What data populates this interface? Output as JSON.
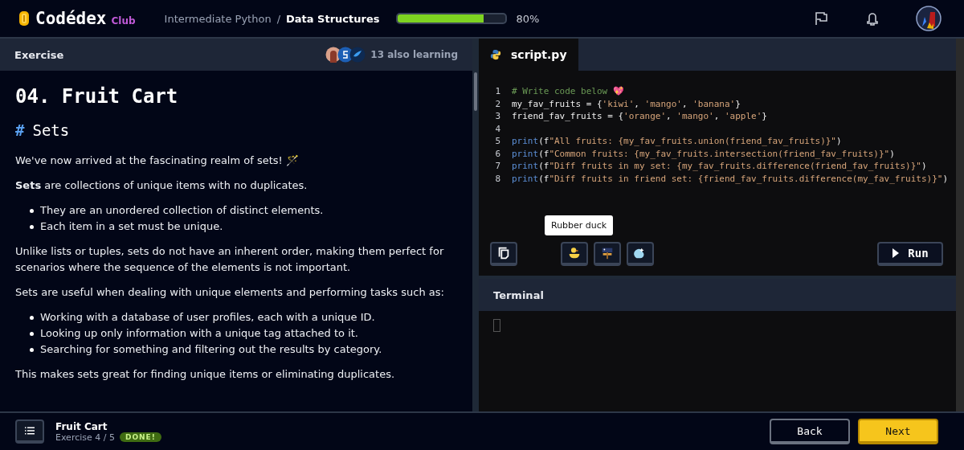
{
  "header": {
    "logo": "Codédex",
    "logo_badge": "Club",
    "breadcrumb": [
      {
        "label": "Intermediate Python",
        "current": false
      },
      {
        "label": "Data Structures",
        "current": true
      }
    ],
    "separator": "/",
    "progress": {
      "level": 0.8,
      "reading": "80%"
    }
  },
  "exercise_panel": {
    "title": "Exercise",
    "learners": "13 also learning",
    "heading": "04. Fruit Cart",
    "subheading_mark": "#",
    "subheading": "Sets",
    "blocks": [
      {
        "kind": "paragraph",
        "text": "We've now arrived at the fascinating realm of sets! 🪄"
      },
      {
        "kind": "paragraph",
        "text": "**Sets** are collections of unique items with no duplicates."
      },
      {
        "kind": "list",
        "items": [
          "They are an unordered collection of distinct elements.",
          "Each item in a set must be unique."
        ]
      },
      {
        "kind": "paragraph",
        "text": "Unlike lists or tuples, sets do not have an inherent order, making them perfect for scenarios where the sequence of the elements is not important."
      },
      {
        "kind": "paragraph",
        "text": "Sets are useful when dealing with unique elements and performing tasks such as:"
      },
      {
        "kind": "list",
        "items": [
          "Working with a database of user profiles, each with a unique ID.",
          "Looking up only information with a unique tag attached to it.",
          "Searching for something and filtering out the results by category."
        ]
      },
      {
        "kind": "paragraph",
        "text": "This makes sets great for finding unique items or eliminating duplicates."
      }
    ]
  },
  "editor": {
    "tab": "script.py",
    "lines": [
      {
        "number": "1",
        "tokens": [
          {
            "kind": "comment",
            "text": "# Write code below 💖"
          }
        ]
      },
      {
        "number": "2",
        "tokens": [
          {
            "kind": "plain",
            "text": "my_fav_fruits = {"
          },
          {
            "kind": "string",
            "text": "'kiwi'"
          },
          {
            "kind": "plain",
            "text": ", "
          },
          {
            "kind": "string",
            "text": "'mango'"
          },
          {
            "kind": "plain",
            "text": ", "
          },
          {
            "kind": "string",
            "text": "'banana'"
          },
          {
            "kind": "plain",
            "text": "}"
          }
        ]
      },
      {
        "number": "3",
        "tokens": [
          {
            "kind": "plain",
            "text": "friend_fav_fruits = {"
          },
          {
            "kind": "string",
            "text": "'orange'"
          },
          {
            "kind": "plain",
            "text": ", "
          },
          {
            "kind": "string",
            "text": "'mango'"
          },
          {
            "kind": "plain",
            "text": ", "
          },
          {
            "kind": "string",
            "text": "'apple'"
          },
          {
            "kind": "plain",
            "text": "}"
          }
        ]
      },
      {
        "number": "4"
      },
      {
        "number": "5",
        "tokens": [
          {
            "kind": "builtin",
            "text": "print"
          },
          {
            "kind": "plain",
            "text": "(f"
          },
          {
            "kind": "string",
            "text": "\"All fruits: {my_fav_fruits.union(friend_fav_fruits)}\""
          },
          {
            "kind": "plain",
            "text": ")"
          }
        ]
      },
      {
        "number": "6",
        "tokens": [
          {
            "kind": "builtin",
            "text": "print"
          },
          {
            "kind": "plain",
            "text": "(f"
          },
          {
            "kind": "string",
            "text": "\"Common fruits: {my_fav_fruits.intersection(friend_fav_fruits)}\""
          },
          {
            "kind": "plain",
            "text": ")"
          }
        ]
      },
      {
        "number": "7",
        "tokens": [
          {
            "kind": "builtin",
            "text": "print"
          },
          {
            "kind": "plain",
            "text": "(f"
          },
          {
            "kind": "string",
            "text": "\"Diff fruits in my set: {my_fav_fruits.difference(friend_fav_fruits)}\""
          },
          {
            "kind": "plain",
            "text": ")"
          }
        ]
      },
      {
        "number": "8",
        "tokens": [
          {
            "kind": "builtin",
            "text": "print"
          },
          {
            "kind": "plain",
            "text": "(f"
          },
          {
            "kind": "string",
            "text": "\"Diff fruits in friend set: {friend_fav_fruits.difference(my_fav_fruits)}\""
          },
          {
            "kind": "plain",
            "text": ")"
          }
        ]
      }
    ],
    "tooltip": "Rubber duck",
    "run_button": "Run"
  },
  "terminal": {
    "title": "Terminal"
  },
  "footer": {
    "title": "Fruit Cart",
    "subtitle": "Exercise 4 / 5",
    "badge": "DONE!",
    "buttons": [
      {
        "label": "Back",
        "kind": "secondary"
      },
      {
        "label": "Next",
        "kind": "primary"
      }
    ]
  }
}
